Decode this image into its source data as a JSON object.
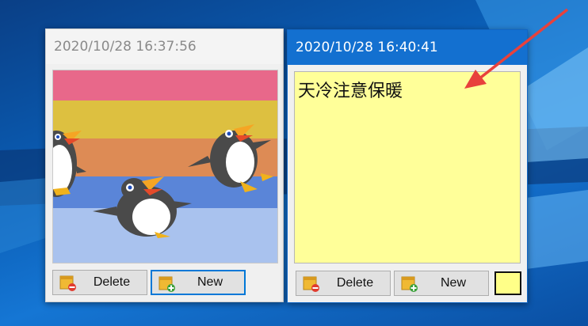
{
  "notes": [
    {
      "timestamp": "2020/10/28 16:37:56",
      "content_type": "image",
      "image_subject": "penguins-on-striped-background",
      "buttons": {
        "delete": "Delete",
        "new": "New"
      }
    },
    {
      "timestamp": "2020/10/28 16:40:41",
      "content_type": "text",
      "text": "天冷注意保暖",
      "buttons": {
        "delete": "Delete",
        "new": "New"
      },
      "note_color": "#ffff99"
    }
  ],
  "colors": {
    "desktop_blue": "#0a5cb3",
    "active_titlebar": "#1370d0",
    "inactive_titlebar": "#f4f4f4",
    "annotation_arrow": "#e8413c",
    "focus_border": "#0078d7"
  },
  "icons": {
    "delete_button": "note-delete-icon",
    "new_button": "note-add-icon",
    "annotation": "red-arrow-icon"
  }
}
